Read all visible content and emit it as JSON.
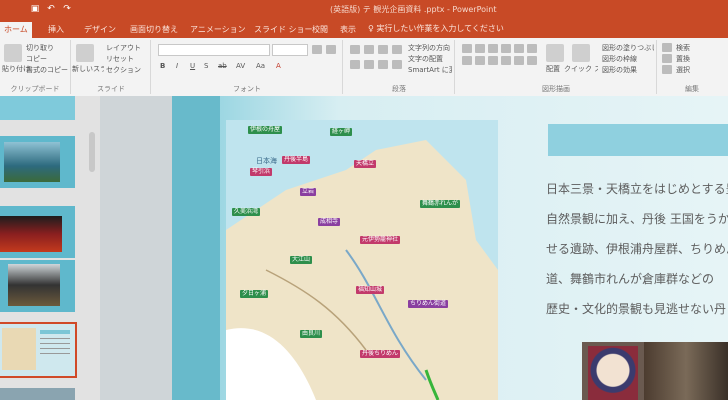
{
  "titlebar": {
    "title": "(英語版) テ 観光企画資料 .pptx  -  PowerPoint",
    "quick_access": [
      "save-icon",
      "undo-icon",
      "redo-icon"
    ]
  },
  "ribbon_tabs": [
    "ホーム",
    "挿入",
    "デザイン",
    "画面切り替え",
    "アニメーション",
    "スライド ショー",
    "校閲",
    "表示"
  ],
  "active_tab_index": 0,
  "tell_me": "♀ 実行したい作業を入力してください",
  "ribbon": {
    "clipboard": {
      "paste": "貼り付け",
      "cut": "切り取り",
      "copy": "コピー",
      "format_painter": "書式のコピー/貼り付け",
      "label": "クリップボード"
    },
    "slides": {
      "new_slide": "新しいスライド",
      "layout": "レイアウト",
      "reset": "リセット",
      "section": "セクション",
      "label": "スライド"
    },
    "font": {
      "label": "フォント",
      "buttons": [
        "B",
        "I",
        "U",
        "S",
        "ab",
        "AV",
        "Aa",
        "A"
      ]
    },
    "paragraph": {
      "label": "段落",
      "text_direction": "文字列の方向",
      "align_text": "文字の配置",
      "smartart": "SmartArt に変換"
    },
    "drawing": {
      "arrange": "配置",
      "quick_styles": "クイック スタイル",
      "shape_fill": "図形の塗りつぶし",
      "shape_outline": "図形の枠線",
      "shape_effects": "図形の効果",
      "label": "図形描画"
    },
    "editing": {
      "find": "検索",
      "replace": "置換",
      "select": "選択",
      "label": "編集"
    }
  },
  "slide_thumbnails": [
    {
      "kind": "title"
    },
    {
      "kind": "island-photo"
    },
    {
      "kind": "shrine-photo"
    },
    {
      "kind": "building-photo"
    },
    {
      "kind": "map-slide",
      "selected": true
    },
    {
      "kind": "partial"
    }
  ],
  "slide": {
    "body_lines": [
      "日本三景・天橋立をはじめとする豊",
      "自然景観に加え、丹後 王国をうかが",
      "せる遺跡、伊根浦舟屋群、ちりめん",
      "道、舞鶴市れんが倉庫群などの",
      "歴史・文化的景観も見逃せない丹"
    ],
    "map_labels": [
      {
        "text": "伊根の舟屋",
        "color": "#2e8f4c"
      },
      {
        "text": "経ヶ岬",
        "color": "#2e8f4c"
      },
      {
        "text": "丹後半島",
        "color": "#c23a6b"
      },
      {
        "text": "琴引浜",
        "color": "#c23a6b"
      },
      {
        "text": "立岩",
        "color": "#8a3fa0"
      },
      {
        "text": "久美浜湾",
        "color": "#2e8f4c"
      },
      {
        "text": "天橋立",
        "color": "#c23a6b"
      },
      {
        "text": "成相寺",
        "color": "#8a3fa0"
      },
      {
        "text": "元伊勢籠神社",
        "color": "#c23a6b"
      },
      {
        "text": "舞鶴赤れんが",
        "color": "#2e8f4c"
      },
      {
        "text": "大江山",
        "color": "#2e8f4c"
      },
      {
        "text": "福知山城",
        "color": "#c23a6b"
      },
      {
        "text": "ちりめん街道",
        "color": "#8a3fa0"
      },
      {
        "text": "由良川",
        "color": "#2e8f4c"
      },
      {
        "text": "丹後ちりめん",
        "color": "#c23a6b"
      },
      {
        "text": "夕日ヶ浦",
        "color": "#2e8f4c"
      }
    ],
    "sea_label": "日本海"
  }
}
